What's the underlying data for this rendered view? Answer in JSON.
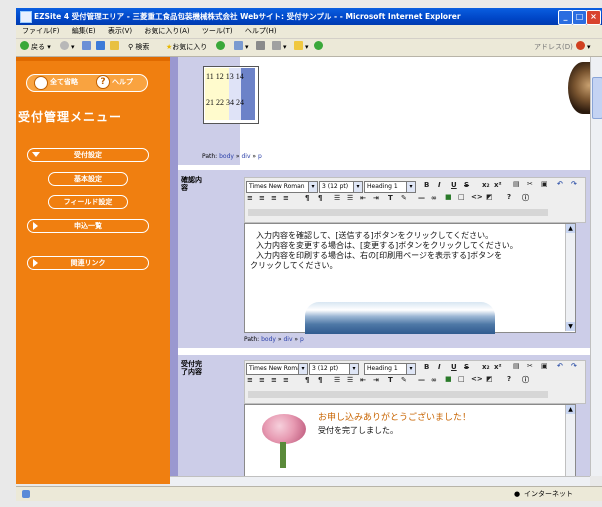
{
  "window": {
    "title": "EZSite 4 受付管理エリア - 三菱重工食品包装機械株式会社 Webサイト: 受付サンプル - - Microsoft Internet Explorer"
  },
  "menubar": {
    "items": [
      "ファイル(F)",
      "編集(E)",
      "表示(V)",
      "お気に入り(A)",
      "ツール(T)",
      "ヘルプ(H)"
    ]
  },
  "toolbar": {
    "back": "戻る",
    "search": "検索",
    "favorites": "お気に入り",
    "address": "アドレス(D)"
  },
  "sidebar": {
    "omit_all": "全て省略",
    "help": "ヘルプ",
    "menu_title": "受付管理メニュー",
    "items": [
      {
        "label": "受付設定"
      },
      {
        "label": "基本設定"
      },
      {
        "label": "フィールド設定"
      },
      {
        "label": "申込一覧"
      },
      {
        "label": "関連リンク"
      }
    ]
  },
  "top_section": {
    "table_rows": [
      [
        "11",
        "12",
        "13",
        "14"
      ],
      [
        "21",
        "22",
        "34",
        "24"
      ]
    ],
    "path_label": "Path:",
    "path_items": [
      "body",
      "div",
      "p"
    ]
  },
  "confirm_section": {
    "label": "確認内容",
    "font_select": "Times New Roman",
    "size_select": "3 (12 pt)",
    "heading_select": "Heading 1",
    "lines": [
      "入力内容を確認して、[送信する]ボタンをクリックしてください。",
      "入力内容を変更する場合は、[変更する]ボタンをクリックしてください。",
      "入力内容を印刷する場合は、右の[印刷用ページを表示する]ボタンを",
      "クリックしてください。"
    ],
    "path_label": "Path:",
    "path_items": [
      "body",
      "div",
      "p"
    ]
  },
  "complete_section": {
    "label": "受付完了内容",
    "font_select": "Times New Roman",
    "size_select": "3 (12 pt)",
    "heading_select": "Heading 1",
    "thanks": "お申し込みありがとうございました！",
    "done": "受付を完了しました。"
  },
  "statusbar": {
    "zone": "インターネット"
  },
  "colors": {
    "sidebar": "#f07f10",
    "gutter": "#cccde8",
    "accent_text": "#c86400"
  }
}
